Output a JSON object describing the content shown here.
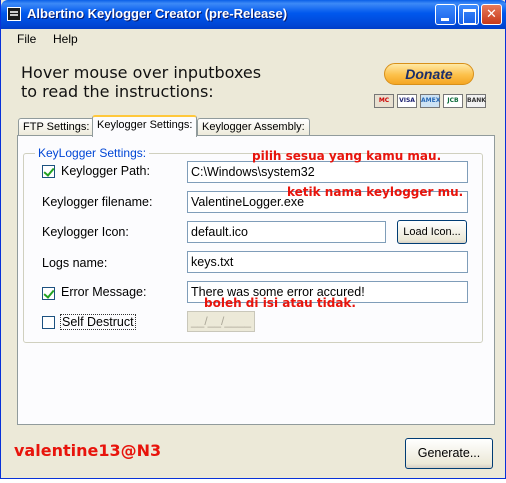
{
  "window": {
    "title": "Albertino Keylogger Creator (pre-Release)"
  },
  "menu": [
    "File",
    "Help"
  ],
  "header": {
    "line1": "Hover mouse over inputboxes",
    "line2": "to read the instructions:"
  },
  "donate": {
    "label": "Donate",
    "cards": [
      "MC",
      "VISA",
      "AMEX",
      "JCB",
      "BANK"
    ]
  },
  "tabs": [
    {
      "label": "FTP Settings:"
    },
    {
      "label": "Keylogger Settings:",
      "active": true
    },
    {
      "label": "Keylogger Assembly:"
    }
  ],
  "group": {
    "title": "KeyLogger Settings:",
    "path_label": "Keylogger Path:",
    "path_value": "C:\\Windows\\system32",
    "path_checked": true,
    "filename_label": "Keylogger filename:",
    "filename_value": "ValentineLogger.exe",
    "icon_label": "Keylogger Icon:",
    "icon_value": "default.ico",
    "load_icon": "Load Icon...",
    "logs_label": "Logs name:",
    "logs_value": "keys.txt",
    "error_label": "Error Message:",
    "error_value": "There was some error accured!",
    "error_checked": true,
    "destruct_label": "Self Destruct",
    "destruct_checked": false,
    "destruct_date": "__/__/____"
  },
  "annotations": {
    "a1": "pilih sesua yang kamu mau.",
    "a2": "ketik nama keylogger mu.",
    "a3": "boleh di isi atau tidak."
  },
  "watermark": "valentine13@N3",
  "generate_label": "Generate..."
}
